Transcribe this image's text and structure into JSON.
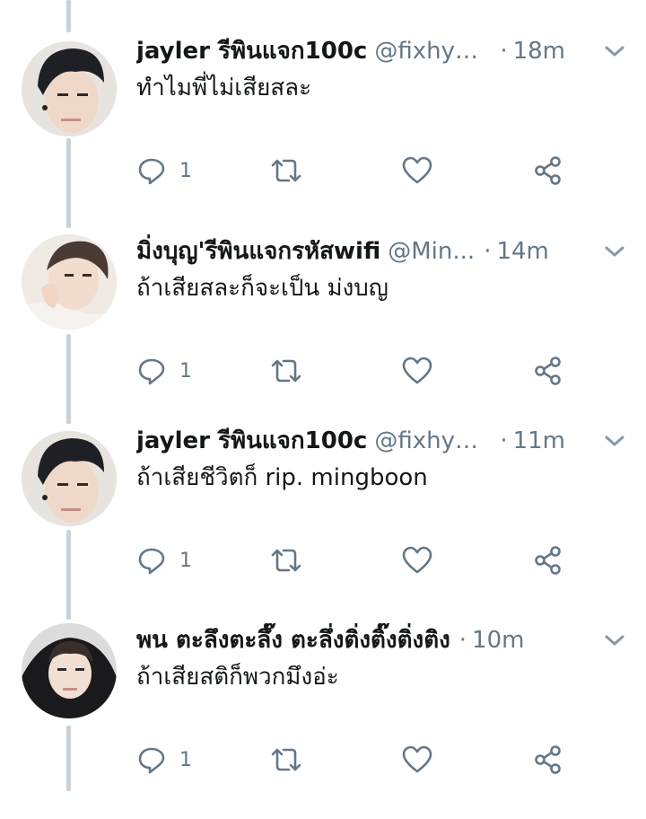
{
  "colors": {
    "text": "#14171a",
    "muted": "#657786",
    "thread_line": "#c9d1d9",
    "icon": "#657786"
  },
  "tweets": [
    {
      "name": "jayler รีพินแจก100c",
      "handle": "@fixhyun...",
      "separator": "·",
      "time": "18m",
      "text": "ทำไมพี่ไม่เสียสละ",
      "reply_count": "1",
      "avatar": "avatar-photo"
    },
    {
      "name": "มิ่งบุญ'รีพินแจกรหัสwifi",
      "handle": "@Min...",
      "separator": "·",
      "time": "14m",
      "text": "ถ้าเสียสละก็จะเป็น ม่งบญ",
      "reply_count": "1",
      "avatar": "avatar-photo"
    },
    {
      "name": "jayler รีพินแจก100c",
      "handle": "@fixhyun...",
      "separator": "·",
      "time": "11m",
      "text": "ถ้าเสียชีวิตก็ rip. mingboon",
      "reply_count": "1",
      "avatar": "avatar-photo"
    },
    {
      "name": "พน ตะลึงตะลึ๊ง ตะลึ่งติ่งติ๊งติ่งติง",
      "handle": "",
      "separator": "·",
      "time": "10m",
      "text": "ถ้าเสียสติก็พวกมึงอ่ะ",
      "reply_count": "1",
      "avatar": "avatar-photo"
    }
  ],
  "icons": {
    "reply": "reply-icon",
    "retweet": "retweet-icon",
    "like": "heart-icon",
    "share": "share-icon",
    "more": "chevron-down-icon"
  }
}
